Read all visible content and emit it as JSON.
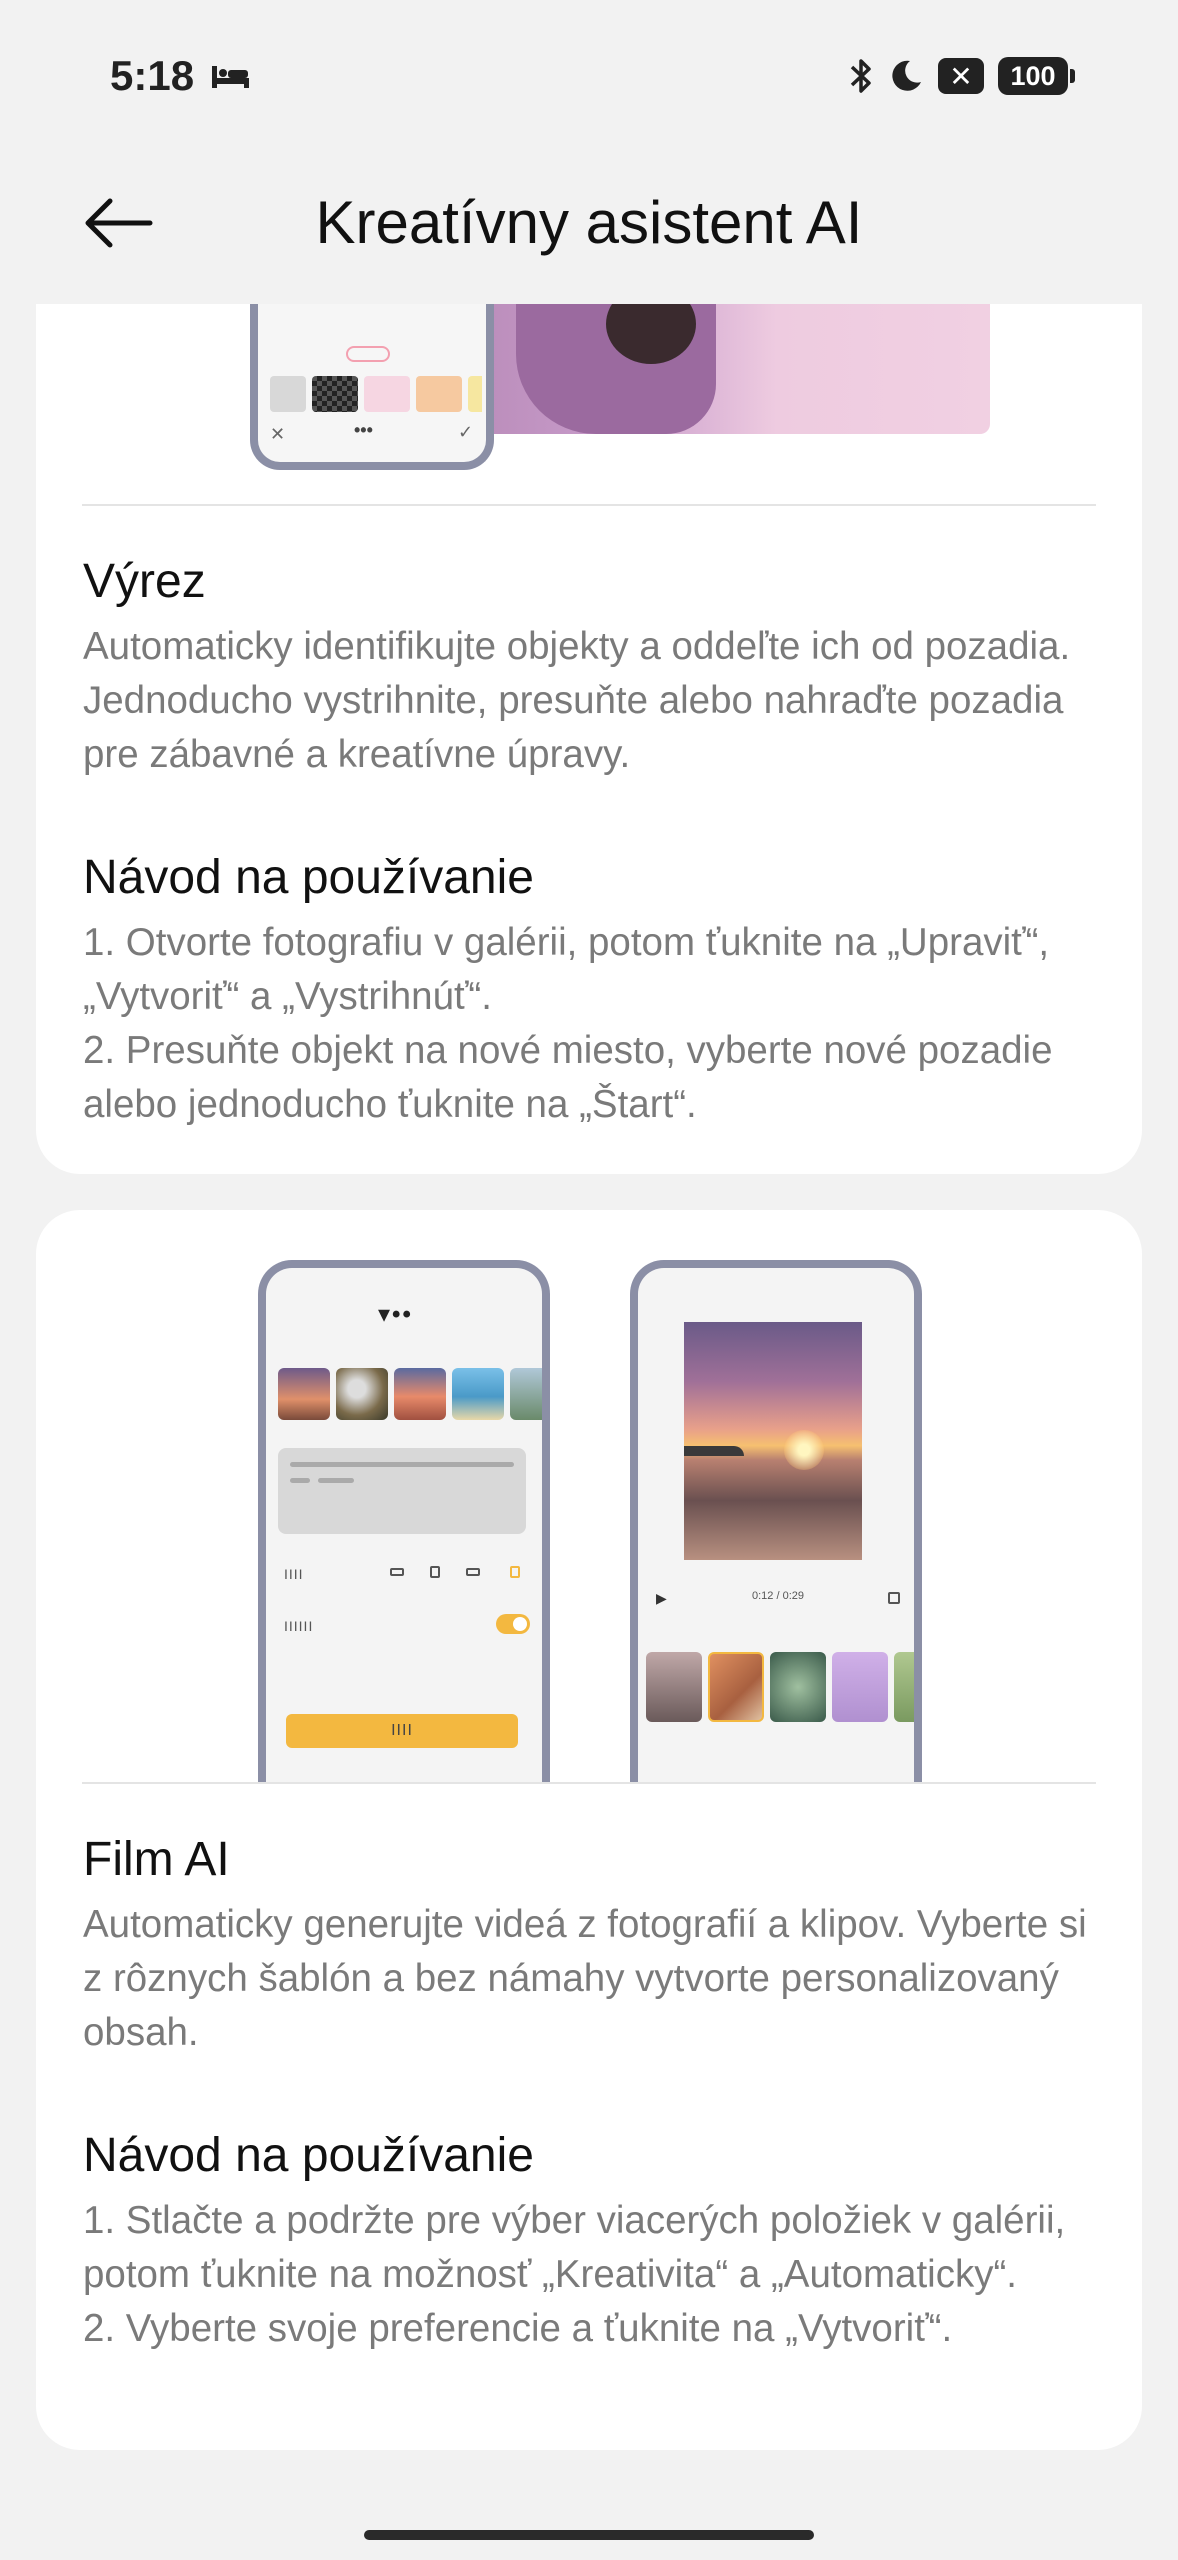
{
  "status": {
    "time": "5:18",
    "battery": "100",
    "icons": [
      "sleep-icon",
      "bluetooth-icon",
      "moon-icon",
      "no-sim-icon",
      "battery-icon"
    ]
  },
  "header": {
    "title": "Kreatívny asistent AI",
    "back_icon": "arrow-left-icon"
  },
  "sections": [
    {
      "title": "Výrez",
      "description": "Automaticky identifikujte objekty a oddeľte ich od pozadia. Jednoducho vystrihnite, presuňte alebo nahraďte pozadia pre zábavné a kreatívne úpravy.",
      "howto_title": "Návod na používanie",
      "howto_steps": "1. Otvorte fotografiu v galérii, potom ťuknite na „Upraviť“, „Vytvoriť“ a „Vystrihnúť“.\n2. Presuňte objekt na nové miesto, vyberte nové pozadie alebo jednoducho ťuknite na „Štart“."
    },
    {
      "title": "Film AI",
      "description": "Automaticky generujte videá z fotografií a klipov. Vyberte si z rôznych šablón a bez námahy vytvorte personalizovaný obsah.",
      "howto_title": "Návod na používanie",
      "howto_steps": "1. Stlačte a podržte pre výber viacerých položiek v galérii, potom ťuknite na možnosť „Kreativita“ a „Automaticky“.\n2. Vyberte svoje preferencie a ťuknite na „Vytvoriť“."
    }
  ],
  "illustration": {
    "video_time": "0:12 / 0:29",
    "accent_color": "#f3b840"
  }
}
